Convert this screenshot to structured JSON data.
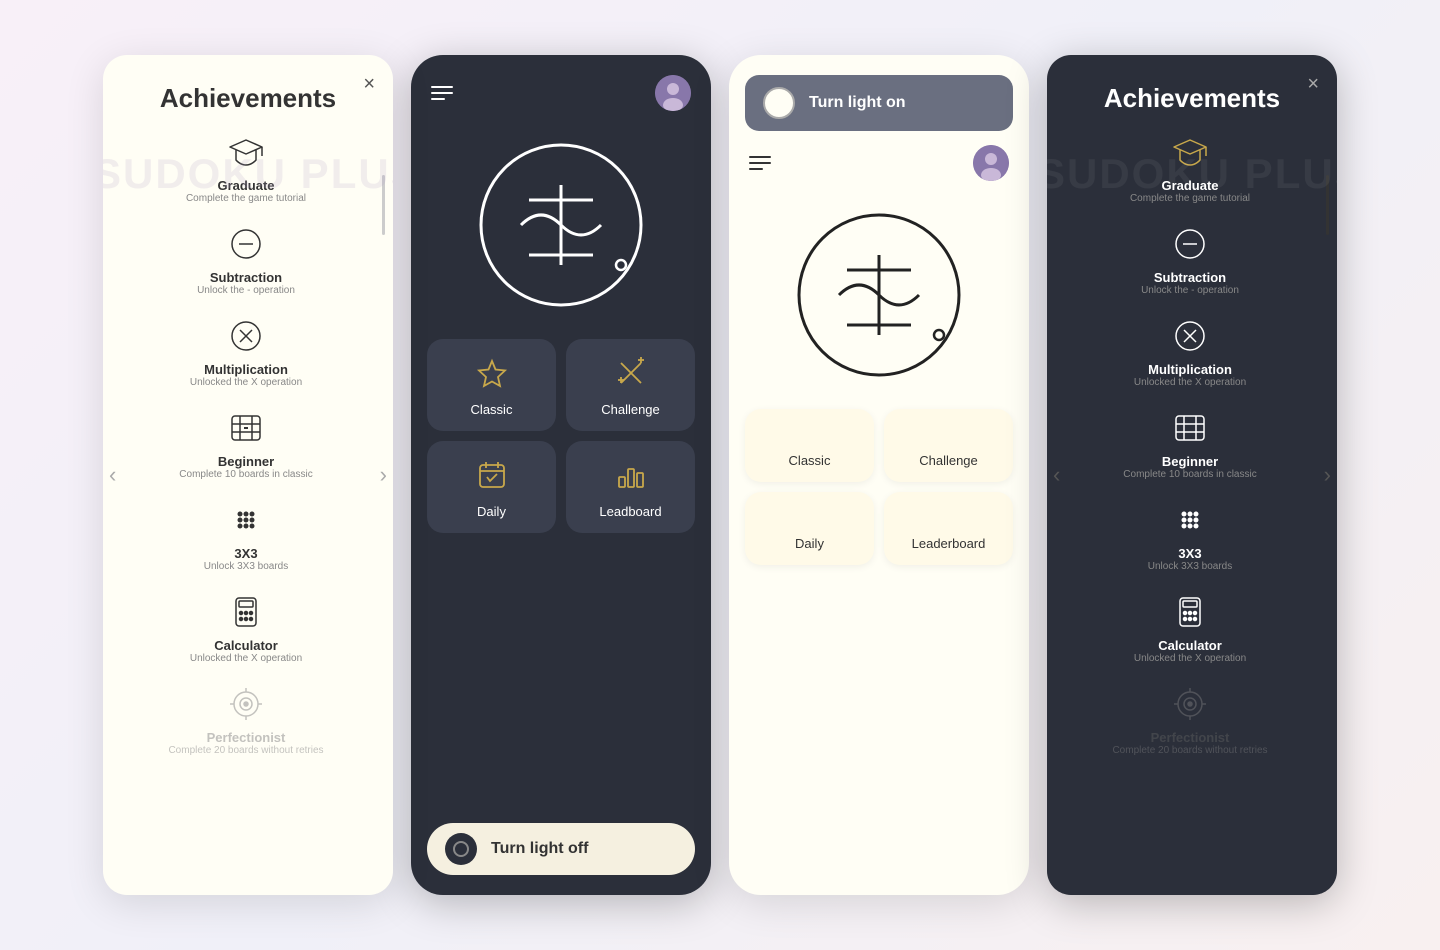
{
  "panels": {
    "achievements_light": {
      "title": "Achievements",
      "bg_text": "SUDOKU PLUS",
      "close_label": "×",
      "items": [
        {
          "name": "Graduate",
          "desc": "Complete the game tutorial",
          "icon": "graduation-cap"
        },
        {
          "name": "Subtraction",
          "desc": "Unlock the - operation",
          "icon": "minus-circle"
        },
        {
          "name": "Multiplication",
          "desc": "Unlocked the X operation",
          "icon": "x-circle"
        },
        {
          "name": "Beginner",
          "desc": "Complete 10 boards in classic",
          "icon": "grid-beginner"
        },
        {
          "name": "3X3",
          "desc": "Unlock 3X3 boards",
          "icon": "dots-3x3"
        },
        {
          "name": "Calculator",
          "desc": "Unlocked the X operation",
          "icon": "calculator"
        },
        {
          "name": "Perfectionist",
          "desc": "Complete 20 boards without retries",
          "icon": "target"
        }
      ]
    },
    "achievements_dark": {
      "title": "Achievements",
      "bg_text": "SUDOKU PLUS",
      "close_label": "×",
      "items": [
        {
          "name": "Graduate",
          "desc": "Complete the game tutorial",
          "icon": "graduation-cap"
        },
        {
          "name": "Subtraction",
          "desc": "Unlock the - operation",
          "icon": "minus-circle"
        },
        {
          "name": "Multiplication",
          "desc": "Unlocked the X operation",
          "icon": "x-circle"
        },
        {
          "name": "Beginner",
          "desc": "Complete 10 boards in classic",
          "icon": "grid-beginner"
        },
        {
          "name": "3X3",
          "desc": "Unlock 3X3 boards",
          "icon": "dots-3x3"
        },
        {
          "name": "Calculator",
          "desc": "Unlocked the X operation",
          "icon": "calculator"
        },
        {
          "name": "Perfectionist",
          "desc": "Complete 20 boards without retries",
          "icon": "target"
        }
      ]
    }
  },
  "phone_dark": {
    "menu_icon": "hamburger",
    "avatar": "👤",
    "tiles": [
      {
        "label": "Classic",
        "icon": "star"
      },
      {
        "label": "Challenge",
        "icon": "swords"
      },
      {
        "label": "Daily",
        "icon": "calendar-check"
      },
      {
        "label": "Leadboard",
        "icon": "bar-chart"
      }
    ],
    "toggle_label": "Turn light off"
  },
  "phone_light": {
    "menu_icon": "hamburger",
    "avatar": "👤",
    "tiles": [
      {
        "label": "Classic",
        "icon": "star"
      },
      {
        "label": "Challenge",
        "icon": "swords"
      },
      {
        "label": "Daily",
        "icon": "calendar-check"
      },
      {
        "label": "Leaderboard",
        "icon": "bar-chart"
      }
    ],
    "toggle_label": "Turn light on"
  }
}
